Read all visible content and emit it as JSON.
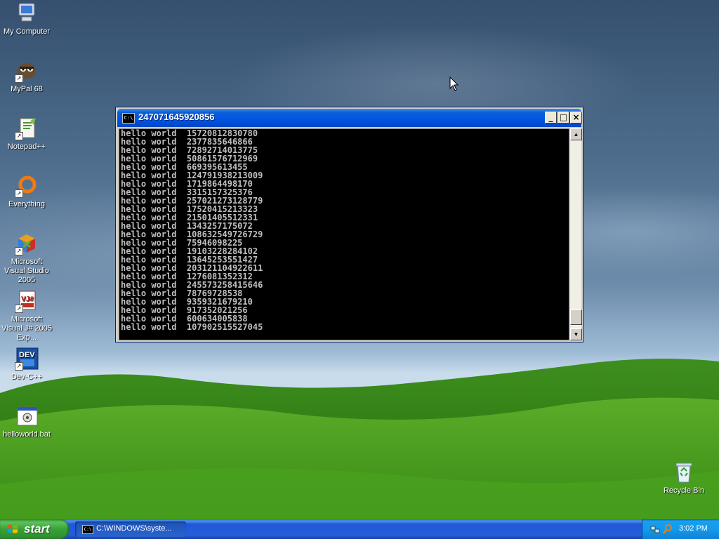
{
  "desktop": {
    "icons": [
      {
        "label": "My Computer",
        "icon": "my-computer-icon"
      },
      {
        "label": "MyPal 68",
        "icon": "mypal-browser-icon"
      },
      {
        "label": "Notepad++",
        "icon": "notepad-plus-plus-icon"
      },
      {
        "label": "Everything",
        "icon": "everything-search-icon"
      },
      {
        "label": "Microsoft Visual Studio 2005",
        "icon": "visual-studio-icon"
      },
      {
        "label": "Microsoft Visual J# 2005 Exp...",
        "icon": "visual-jsharp-icon"
      },
      {
        "label": "Dev-C++",
        "icon": "dev-cpp-icon"
      },
      {
        "label": "helloworld.bat",
        "icon": "batch-file-icon"
      },
      {
        "label": "Recycle Bin",
        "icon": "recycle-bin-icon"
      }
    ]
  },
  "console_window": {
    "title": "247071645920856",
    "buttons": {
      "minimize": "_",
      "maximize": "□",
      "close": "×"
    },
    "lines": [
      "hello world  15720812830780",
      "hello world  2377835646866",
      "hello world  72892714013775",
      "hello world  50861576712969",
      "hello world  669395613455",
      "hello world  124791938213009",
      "hello world  1719864498170",
      "hello world  3315157325376",
      "hello world  257021273128779",
      "hello world  17520415213323",
      "hello world  21501405512331",
      "hello world  1343257175072",
      "hello world  108632549726729",
      "hello world  75946098225",
      "hello world  19103228284102",
      "hello world  13645253551427",
      "hello world  203121104922611",
      "hello world  1276081352312",
      "hello world  245573258415646",
      "hello world  78769728538",
      "hello world  9359321679210",
      "hello world  917352021256",
      "hello world  600634005838",
      "hello world  107902515527045"
    ],
    "scroll_position": 0.98
  },
  "taskbar": {
    "start_label": "start",
    "task_label": "C:\\WINDOWS\\syste...",
    "clock": "3:02 PM"
  }
}
